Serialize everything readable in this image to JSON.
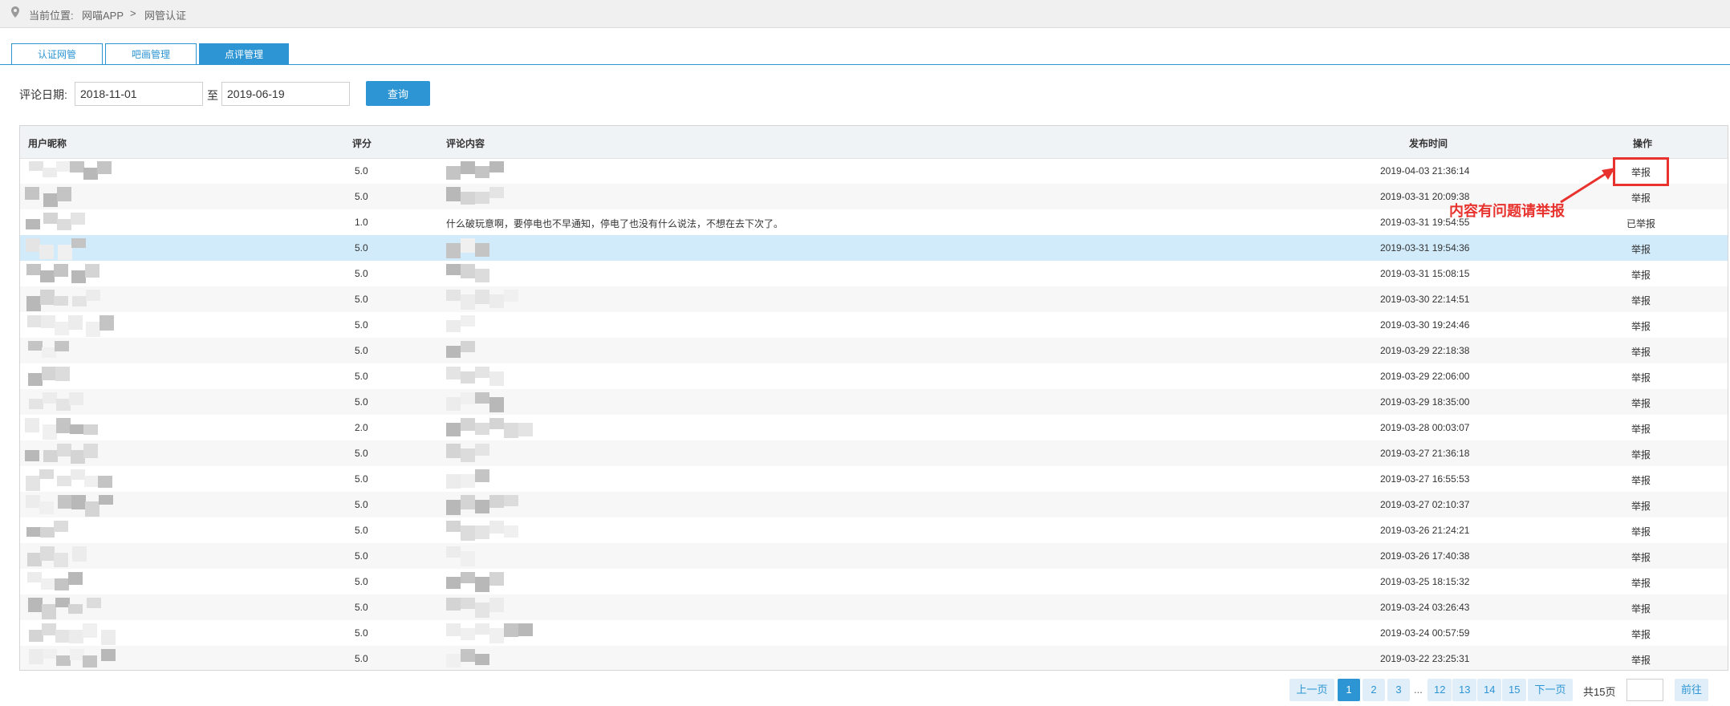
{
  "breadcrumb": {
    "location_label": "当前位置:",
    "item1": "网喵APP",
    "separator": ">",
    "item2": "网管认证"
  },
  "tabs": [
    {
      "label": "认证网管",
      "active": false
    },
    {
      "label": "吧画管理",
      "active": false
    },
    {
      "label": "点评管理",
      "active": true
    }
  ],
  "filter": {
    "label": "评论日期:",
    "start_date": "2018-11-01",
    "to_label": "至",
    "end_date": "2019-06-19",
    "query_label": "查询"
  },
  "table": {
    "headers": {
      "nickname": "用户昵称",
      "score": "评分",
      "content": "评论内容",
      "time": "发布时间",
      "action": "操作"
    },
    "rows": [
      {
        "score": "5.0",
        "content": "",
        "time": "2019-04-03 21:36:14",
        "action": "举报"
      },
      {
        "score": "5.0",
        "content": "",
        "time": "2019-03-31 20:09:38",
        "action": "举报"
      },
      {
        "score": "1.0",
        "content": "什么破玩意啊，要停电也不早通知，停电了也没有什么说法，不想在去下次了。",
        "time": "2019-03-31 19:54:55",
        "action": "已举报"
      },
      {
        "score": "5.0",
        "content": "",
        "time": "2019-03-31 19:54:36",
        "action": "举报"
      },
      {
        "score": "5.0",
        "content": "",
        "time": "2019-03-31 15:08:15",
        "action": "举报"
      },
      {
        "score": "5.0",
        "content": "",
        "time": "2019-03-30 22:14:51",
        "action": "举报"
      },
      {
        "score": "5.0",
        "content": "",
        "time": "2019-03-30 19:24:46",
        "action": "举报"
      },
      {
        "score": "5.0",
        "content": "",
        "time": "2019-03-29 22:18:38",
        "action": "举报"
      },
      {
        "score": "5.0",
        "content": "",
        "time": "2019-03-29 22:06:00",
        "action": "举报"
      },
      {
        "score": "5.0",
        "content": "",
        "time": "2019-03-29 18:35:00",
        "action": "举报"
      },
      {
        "score": "2.0",
        "content": "",
        "time": "2019-03-28 00:03:07",
        "action": "举报"
      },
      {
        "score": "5.0",
        "content": "",
        "time": "2019-03-27 21:36:18",
        "action": "举报"
      },
      {
        "score": "5.0",
        "content": "",
        "time": "2019-03-27 16:55:53",
        "action": "举报"
      },
      {
        "score": "5.0",
        "content": "",
        "time": "2019-03-27 02:10:37",
        "action": "举报"
      },
      {
        "score": "5.0",
        "content": "",
        "time": "2019-03-26 21:24:21",
        "action": "举报"
      },
      {
        "score": "5.0",
        "content": "",
        "time": "2019-03-26 17:40:38",
        "action": "举报"
      },
      {
        "score": "5.0",
        "content": "",
        "time": "2019-03-25 18:15:32",
        "action": "举报"
      },
      {
        "score": "5.0",
        "content": "",
        "time": "2019-03-24 03:26:43",
        "action": "举报"
      },
      {
        "score": "5.0",
        "content": "",
        "time": "2019-03-24 00:57:59",
        "action": "举报"
      },
      {
        "score": "5.0",
        "content": "",
        "time": "2019-03-22 23:25:31",
        "action": "举报"
      }
    ]
  },
  "annotation": {
    "text": "内容有问题请举报",
    "color": "#e8322d"
  },
  "pagination": {
    "prev_label": "上一页",
    "pages": [
      "1",
      "2",
      "3"
    ],
    "ellipsis": "...",
    "pages_tail": [
      "12",
      "13",
      "14",
      "15"
    ],
    "next_label": "下一页",
    "total_label": "共15页",
    "go_label": "前往",
    "current": "1"
  },
  "colors": {
    "accent": "#2d95d3",
    "highlight_row": "#d2ebfa",
    "annotation": "#e8322d"
  }
}
